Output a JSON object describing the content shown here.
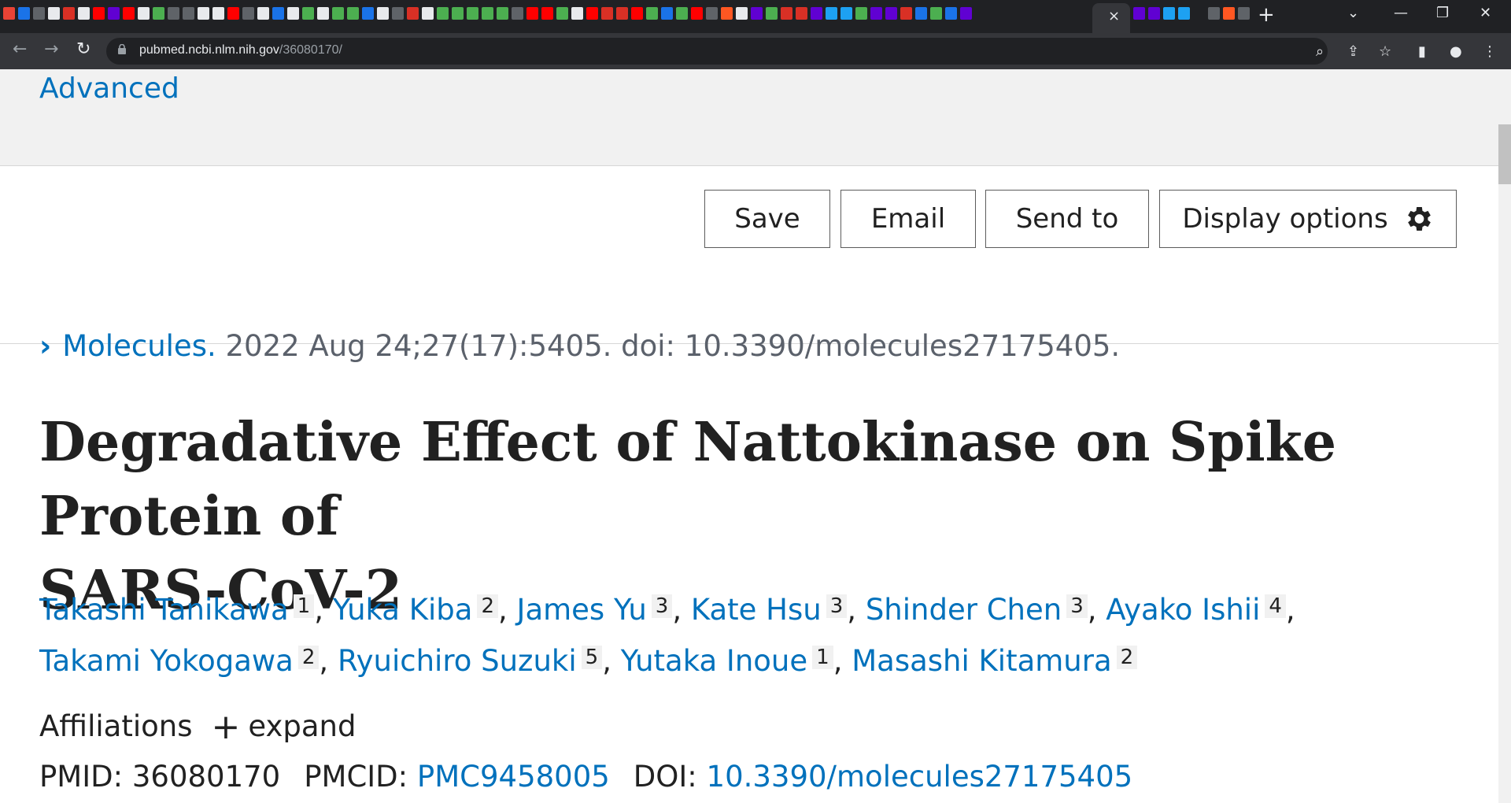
{
  "browser": {
    "tab_icons": [
      "#ea4335",
      "#1a73e8",
      "#5f6368",
      "#e8eaed",
      "#d93025",
      "#e8eaed",
      "#ff0000",
      "#6001d2",
      "#ff0000",
      "#e8eaed",
      "#4caf50",
      "#5f6368",
      "#5f6368",
      "#e8eaed",
      "#e8eaed",
      "#ff0000",
      "#5f6368",
      "#e8eaed",
      "#1a73e8",
      "#e8eaed",
      "#4caf50",
      "#e8eaed",
      "#4caf50",
      "#4caf50",
      "#1a73e8",
      "#e8eaed",
      "#5f6368",
      "#d93025",
      "#e8eaed",
      "#4caf50",
      "#4caf50",
      "#4caf50",
      "#4caf50",
      "#4caf50",
      "#5f6368",
      "#ff0000",
      "#ff0000",
      "#4caf50",
      "#e8eaed",
      "#ff0000",
      "#d93025",
      "#d93025",
      "#ff0000",
      "#4caf50",
      "#1a73e8",
      "#4caf50",
      "#ff0000",
      "#5f6368",
      "#ff5722",
      "#e8eaed",
      "#6001d2",
      "#4caf50",
      "#d93025",
      "#d93025",
      "#6001d2",
      "#1da1f2",
      "#1da1f2",
      "#4caf50",
      "#6001d2",
      "#6001d2",
      "#d93025",
      "#1a73e8",
      "#4caf50",
      "#1a73e8",
      "#6001d2"
    ],
    "tab_icons_after": [
      "#6001d2",
      "#6001d2",
      "#1da1f2",
      "#1da1f2",
      "#202124",
      "#5f6368",
      "#ff5722",
      "#5f6368"
    ],
    "close_tab_icon": "×",
    "new_tab_icon": "+",
    "url_host": "pubmed.ncbi.nlm.nih.gov",
    "url_path": "/36080170/",
    "window_controls": {
      "dropdown": "⌄",
      "minimize": "—",
      "restore": "❐",
      "close": "✕"
    }
  },
  "search": {
    "advanced_label": "Advanced"
  },
  "actions": {
    "save": "Save",
    "email": "Email",
    "send_to": "Send to",
    "display_options": "Display options"
  },
  "citation": {
    "journal": "Molecules.",
    "details": " 2022 Aug 24;27(17):5405. doi: 10.3390/molecules27175405."
  },
  "article": {
    "title_line1": "Degradative Effect of Nattokinase on Spike Protein of",
    "title_line2": "SARS-CoV-2"
  },
  "authors": [
    {
      "name": "Takashi Tanikawa",
      "aff": "1"
    },
    {
      "name": "Yuka Kiba",
      "aff": "2"
    },
    {
      "name": "James Yu",
      "aff": "3"
    },
    {
      "name": "Kate Hsu",
      "aff": "3"
    },
    {
      "name": "Shinder Chen",
      "aff": "3"
    },
    {
      "name": "Ayako Ishii",
      "aff": "4"
    },
    {
      "name": "Takami Yokogawa",
      "aff": "2"
    },
    {
      "name": "Ryuichiro Suzuki",
      "aff": "5"
    },
    {
      "name": "Yutaka Inoue",
      "aff": "1"
    },
    {
      "name": "Masashi Kitamura",
      "aff": "2"
    }
  ],
  "affiliations": {
    "label": "Affiliations",
    "expand": "expand"
  },
  "ids": {
    "pmid_label": "PMID:",
    "pmid": "36080170",
    "pmcid_label": "PMCID:",
    "pmcid": "PMC9458005",
    "doi_label": "DOI:",
    "doi": "10.3390/molecules27175405"
  }
}
